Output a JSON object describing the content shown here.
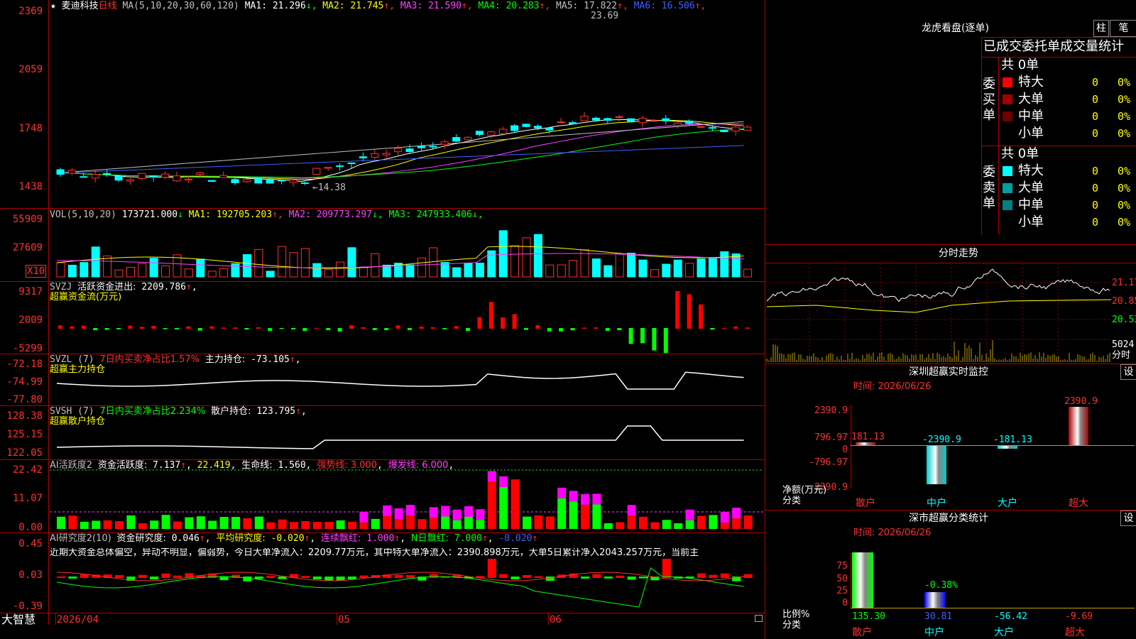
{
  "brand": "大智慧",
  "main": {
    "star": "★",
    "stock_name": "麦迪科技",
    "period": "日线",
    "ma_label": "MA(5,10,20,30,60,120)",
    "ma": [
      {
        "label": "MA1:",
        "value": "21.296",
        "arrow": "↓",
        "color": "#ffffff"
      },
      {
        "label": "MA2:",
        "value": "21.745",
        "arrow": "↑",
        "color": "#ffff00"
      },
      {
        "label": "MA3:",
        "value": "21.590",
        "arrow": "↑",
        "color": "#ff40ff"
      },
      {
        "label": "MA4:",
        "value": "20.283",
        "arrow": "↑",
        "color": "#00ff00"
      },
      {
        "label": "MA5:",
        "value": "17.822",
        "arrow": "↑",
        "color": "#c0c0c0"
      },
      {
        "label": "MA6:",
        "value": "16.506",
        "arrow": "↑",
        "color": "#4060ff"
      }
    ],
    "axis": [
      "2369",
      "2059",
      "1748",
      "1438"
    ],
    "high_label": "23.69",
    "low_label": "←14.38"
  },
  "vol": {
    "label": "VOL(5,10,20)",
    "value": "173721.000",
    "value_arrow": "↓",
    "ma": [
      {
        "label": "MA1:",
        "value": "192705.203",
        "arrow": "↑",
        "color": "#ffff00"
      },
      {
        "label": "MA2:",
        "value": "209773.297",
        "arrow": "↓",
        "color": "#ff40ff"
      },
      {
        "label": "MA3:",
        "value": "247933.406",
        "arrow": "↓",
        "color": "#00ff00"
      }
    ],
    "axis": [
      "55909",
      "27609"
    ],
    "unit": "X10"
  },
  "svzj": {
    "label": "SVZJ",
    "line1": "活跃资金进出:",
    "value": "2209.786",
    "arrow": "↑",
    "sub": "超赢资金流(万元)",
    "axis": [
      "9317",
      "2009",
      "-5299"
    ]
  },
  "svzl": {
    "label": "SVZL (7)",
    "pct": "7日内买卖净占比1.57%",
    "hold": "主力持仓:",
    "value": "-73.105",
    "arrow": "↑",
    "sub": "超赢主力持仓",
    "axis": [
      "-72.18",
      "-74.99",
      "-77.80"
    ]
  },
  "svsh": {
    "label": "SVSH (7)",
    "pct": "7日内买卖净占比2.234%",
    "hold": "散户持仓:",
    "value": "123.795",
    "arrow": "↑",
    "sub": "超赢散户持仓",
    "axis": [
      "128.38",
      "125.15",
      "122.05"
    ]
  },
  "ai2": {
    "label": "AI活跃度2",
    "act_label": "资金活跃度:",
    "act_value": "7.137",
    "act_arrow": "↑",
    "v2": "22.419",
    "life_label": "生命线:",
    "life_value": "1.560",
    "strong": "强势线: 3.000",
    "burst": "爆发线: 6.000",
    "axis": [
      "22.42",
      "11.07",
      "0.00"
    ]
  },
  "air": {
    "label": "AI研究度2(10)",
    "res_label": "资金研究度:",
    "res_value": "0.046",
    "avg_label": "平均研究度:",
    "avg_value": "-0.020",
    "lh_label": "连续飘红:",
    "lh_value": "1.000",
    "nd_label": "N日飘红:",
    "nd_value": "7.000",
    "tail": "-0.020",
    "comment": "近期大资金总体偏空，异动不明显，偏弱势，今日大单净流入：2209.77万元，其中特大单净流入：2390.898万元，大单5日累计净入2043.257万元，当前主",
    "axis": [
      "0.45",
      "0.03",
      "-0.39"
    ]
  },
  "xaxis": [
    "2026/04",
    "05",
    "06"
  ],
  "right": {
    "lh_title": "龙虎看盘(逐单)",
    "btn_zhu": "柱",
    "btn_bi": "笔",
    "stat_title": "已成交委托单成交量统计",
    "buy": {
      "side": "委买单",
      "total": "共 0单",
      "rows": [
        {
          "name": "特大",
          "count": "0",
          "pct": "0%",
          "color": "#ff0000"
        },
        {
          "name": "大单",
          "count": "0",
          "pct": "0%",
          "color": "#a00000"
        },
        {
          "name": "中单",
          "count": "0",
          "pct": "0%",
          "color": "#700000"
        },
        {
          "name": "小单",
          "count": "0",
          "pct": "0%",
          "color": ""
        }
      ]
    },
    "sell": {
      "side": "委卖单",
      "total": "共 0单",
      "rows": [
        {
          "name": "特大",
          "count": "0",
          "pct": "0%",
          "color": "#00ffff"
        },
        {
          "name": "大单",
          "count": "0",
          "pct": "0%",
          "color": "#00a0a0"
        },
        {
          "name": "中单",
          "count": "0",
          "pct": "0%",
          "color": "#008080"
        },
        {
          "name": "小单",
          "count": "0",
          "pct": "0%",
          "color": ""
        }
      ]
    },
    "intraday_title": "分时走势",
    "intraday_axis": [
      "21.17",
      "20.85",
      "20.53"
    ],
    "intraday_vol": "5024",
    "intraday_vol_label": "分时",
    "sz_title": "深圳超赢实时监控",
    "sz_btn": "设",
    "sz_time": "时间: 2026/06/26",
    "sz_axis": [
      "2390.9",
      "796.97",
      "0",
      "-796.97",
      "-2390.9"
    ],
    "sz_net_label": "净额(万元)",
    "sz_cat_label": "分类",
    "sz_bars": [
      {
        "cat": "散户",
        "value": 181.13,
        "label": "181.13"
      },
      {
        "cat": "中户",
        "value": -2390.9,
        "label": "-2390.9"
      },
      {
        "cat": "大户",
        "value": -181.13,
        "label": "-181.13"
      },
      {
        "cat": "超大",
        "value": 2390.9,
        "label": "2390.9"
      }
    ],
    "cls_title": "深市超赢分类统计",
    "cls_btn": "设",
    "cls_time": "时间: 2026/06/26",
    "cls_axis": [
      "75",
      "50",
      "25",
      "0"
    ],
    "cls_ratio_label": "比例%",
    "cls_cat_label": "分类",
    "cls_mid_label": "-0.38%",
    "cls_bars": [
      {
        "cat": "散户",
        "value": 135.3,
        "label": "135.30"
      },
      {
        "cat": "中户",
        "value": 30.81,
        "label": "30.81"
      },
      {
        "cat": "大户",
        "value": -56.42,
        "label": "-56.42"
      },
      {
        "cat": "超大",
        "value": -9.69,
        "label": "-9.69"
      }
    ]
  }
}
